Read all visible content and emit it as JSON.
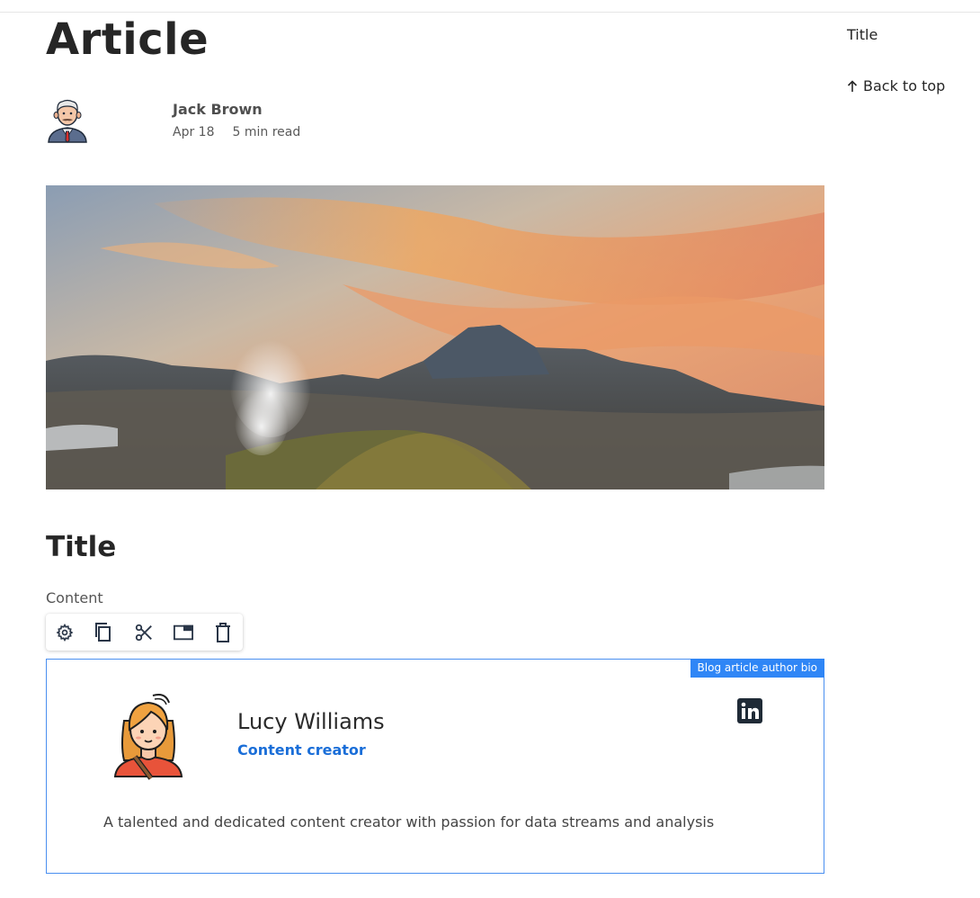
{
  "article": {
    "title": "Article",
    "author_name": "Jack Brown",
    "date": "Apr 18",
    "read_time": "5 min read",
    "section_title": "Title",
    "content": "Content"
  },
  "hero": {
    "icon": "volcano-landscape-image"
  },
  "toolbar": {
    "icons": [
      "gear-icon",
      "copy-icon",
      "cut-icon",
      "window-icon",
      "trash-icon"
    ]
  },
  "bio": {
    "badge": "Blog article author bio",
    "name": "Lucy Williams",
    "role": "Content creator",
    "description": "A talented and dedicated content creator with passion for data streams and analysis",
    "social_icon": "linkedin-icon"
  },
  "sidebar": {
    "toc_title": "Title",
    "back_to_top": "Back to top",
    "back_icon": "arrow-up-icon"
  },
  "colors": {
    "accent": "#2f86f6",
    "role_text": "#1a6ed8"
  }
}
